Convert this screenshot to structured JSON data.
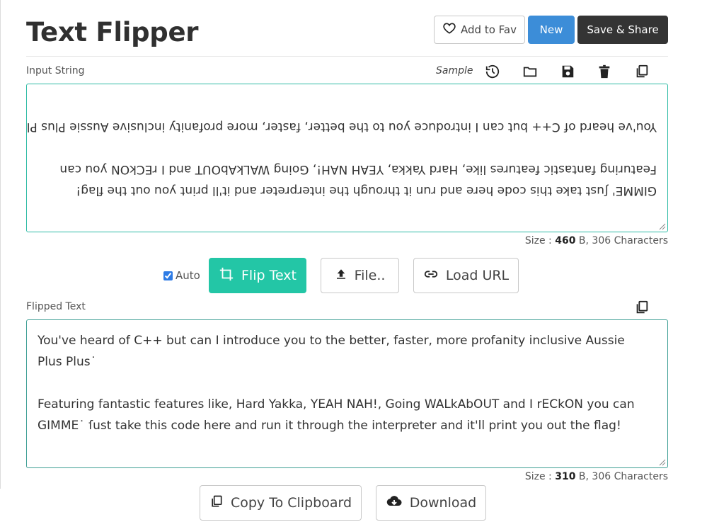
{
  "header": {
    "title": "Text Flipper",
    "fav_label": "Add to Fav",
    "new_label": "New",
    "save_label": "Save & Share"
  },
  "input": {
    "label": "Input String",
    "sample_label": "Sample",
    "lines": [
      "GIMME' ʃust take this code here and run it through the interpreter and it'll print you out the flag!",
      "Featuring fantastic features like, Hard Yakka, YEAH NAH!, Going WALkAbOUT and I rECkON you can",
      "",
      "You've heard of C++ but can I introduce you to the better, faster, more profanity inclusive Aussie Plus Plus"
    ],
    "size_label": "Size :",
    "size_bytes": "460",
    "size_rest": "B, 306 Characters"
  },
  "controls": {
    "auto_label": "Auto",
    "auto_checked": true,
    "flip_label": "Flip Text",
    "file_label": "File..",
    "url_label": "Load URL"
  },
  "output": {
    "label": "Flipped Text",
    "lines": [
      "You've heard of C++ but can I introduce you to the better, faster, more profanity inclusive Aussie",
      "Plus Plus˙",
      "",
      "Featuring fantastic features like, Hard Yakka, YEAH NAH!, Going WALkAbOUT and I rECkON you can",
      "GIMME˙ ſust take this code here and run it through the interpreter and it'll print you out the flag!"
    ],
    "size_label": "Size :",
    "size_bytes": "310",
    "size_rest": "B, 306 Characters",
    "copy_label": "Copy To Clipboard",
    "download_label": "Download"
  },
  "icons": {
    "fav": "heart-icon",
    "history": "history-icon",
    "open": "folder-icon",
    "save": "save-icon",
    "delete": "trash-icon",
    "copy": "copy-icon",
    "flip": "crop-icon",
    "file": "upload-icon",
    "url": "link-icon",
    "download": "cloud-download-icon"
  },
  "colors": {
    "accent_teal": "#23c6a6",
    "new_blue": "#3c8dd8",
    "dark_button": "#343434"
  }
}
